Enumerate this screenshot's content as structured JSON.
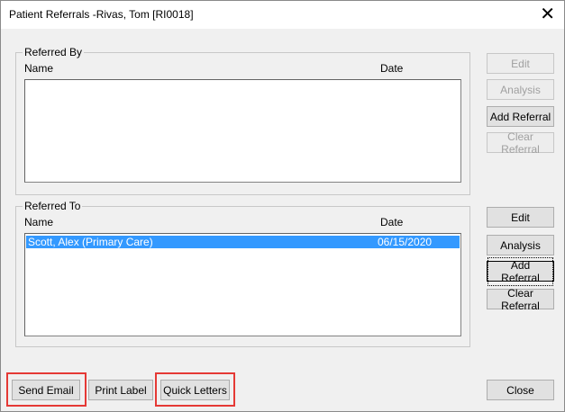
{
  "window": {
    "title": "Patient Referrals -Rivas, Tom [RI0018]",
    "close_glyph": "✕"
  },
  "referred_by": {
    "label": "Referred By",
    "col_name": "Name",
    "col_date": "Date",
    "rows": [],
    "buttons": {
      "edit": "Edit",
      "analysis": "Analysis",
      "add": "Add Referral",
      "clear": "Clear Referral"
    }
  },
  "referred_to": {
    "label": "Referred To",
    "col_name": "Name",
    "col_date": "Date",
    "rows": [
      {
        "name": "Scott, Alex (Primary Care)",
        "date": "06/15/2020"
      }
    ],
    "buttons": {
      "edit": "Edit",
      "analysis": "Analysis",
      "add": "Add Referral",
      "clear": "Clear Referral"
    }
  },
  "footer": {
    "send_email": "Send Email",
    "print_label": "Print Label",
    "quick_letters": "Quick Letters",
    "close": "Close"
  },
  "colors": {
    "selection": "#3399ff",
    "highlight_box": "#e53935"
  }
}
